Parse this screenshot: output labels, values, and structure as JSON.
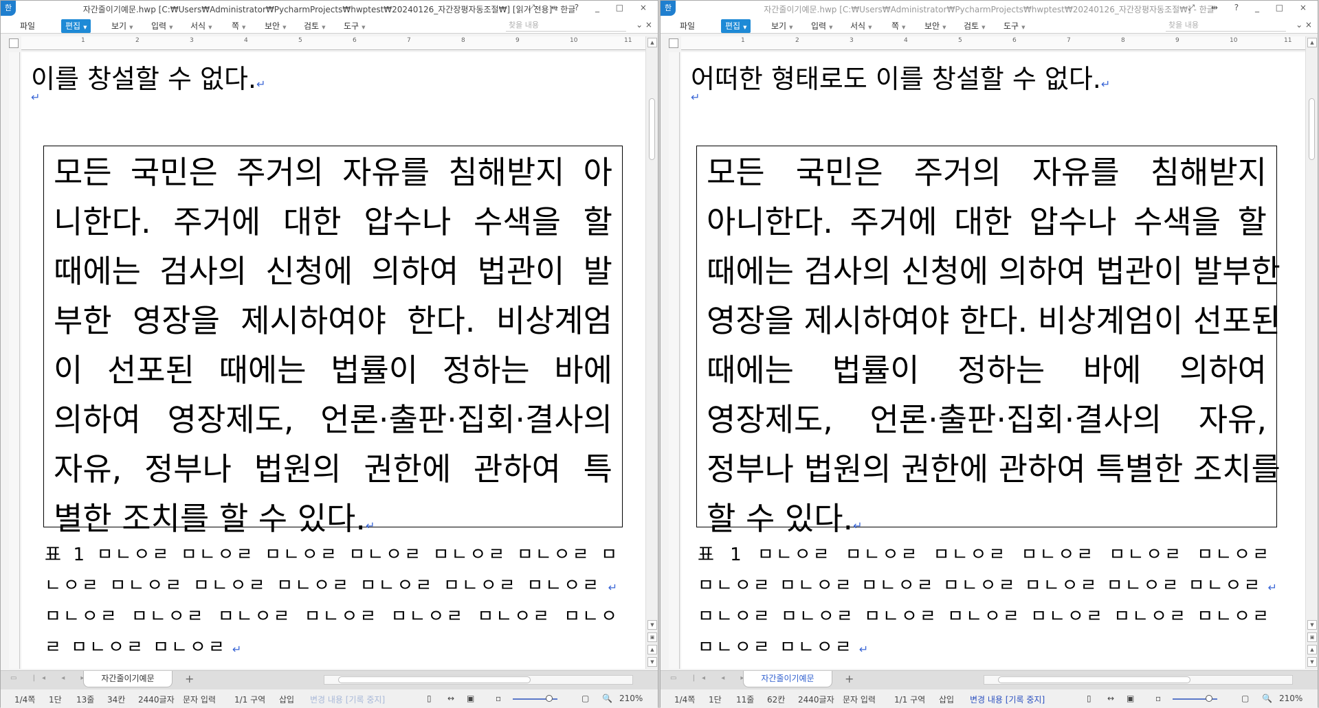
{
  "menu_items": [
    "파일",
    "편집",
    "보기",
    "입력",
    "서식",
    "쪽",
    "보안",
    "검토",
    "도구"
  ],
  "search_placeholder": "찾을 내용",
  "ruler_marks": [
    "1",
    "2",
    "3",
    "4",
    "5",
    "6",
    "7",
    "8",
    "9",
    "10",
    "11"
  ],
  "window_controls": "⤢ ⇹ ? _ □ ×",
  "colors": {
    "accent": "#1e8ad6",
    "return_mark": "#3a66d6",
    "track_changes_active": "#2a4fbf"
  },
  "windows": [
    {
      "app_icon": "한",
      "title": "자간줄이기예문.hwp [C:₩Users₩Administrator₩PycharmProjects₩hwptest₩20240126_자간장평자동조절₩] [읽기 전용] - 한글",
      "first_line": "이를 창설할 수 없다.",
      "box_lines": [
        "모든 국민은 주거의 자유를 침해받지 아",
        "니한다. 주거에 대한 압수나 수색을 할",
        "때에는 검사의 신청에 의하여 법관이 발",
        "부한 영장을 제시하여야 한다. 비상계엄",
        "이 선포된 때에는 법률이 정하는 바에",
        "의하여 영장제도, 언론·출판·집회·결사의",
        "자유, 정부나 법원의 권한에 관하여 특",
        "별한 조치를 할 수 있다."
      ],
      "caption_lines": [
        "표 1 ㅁㄴㅇㄹ ㅁㄴㅇㄹ ㅁㄴㅇㄹ ㅁㄴㅇㄹ ㅁㄴㅇㄹ ㅁㄴㅇㄹ ㅁ",
        "ㄴㅇㄹ ㅁㄴㅇㄹ ㅁㄴㅇㄹ ㅁㄴㅇㄹ ㅁㄴㅇㄹ ㅁㄴㅇㄹ ㅁㄴㅇㄹ",
        "ㅁㄴㅇㄹ ㅁㄴㅇㄹ ㅁㄴㅇㄹ ㅁㄴㅇㄹ ㅁㄴㅇㄹ ㅁㄴㅇㄹ ㅁㄴㅇ",
        "ㄹ ㅁㄴㅇㄹ ㅁㄴㅇㄹ"
      ],
      "caption_return_after": [
        1,
        3
      ],
      "doc_tab": "자간줄이기예문",
      "status": [
        "1/4쪽",
        "1단",
        "13줄",
        "34칸",
        "2440글자",
        "문자 입력",
        "1/1 구역",
        "삽입",
        "변경 내용 [기록 중지]",
        "210%"
      ],
      "track_changes_active": false
    },
    {
      "app_icon": "한",
      "title": "자간줄이기예문.hwp [C:₩Users₩Administrator₩PycharmProjects₩hwptest₩20240126_자간장평자동조절₩] - 한글",
      "first_line": "어떠한 형태로도 이를 창설할 수 없다.",
      "box_lines": [
        "모든 국민은 주거의 자유를 침해받지",
        "아니한다. 주거에 대한 압수나 수색을 할",
        "때에는 검사의 신청에 의하여 법관이 발부한",
        "영장을 제시하여야 한다. 비상계엄이 선포된",
        "때에는 법률이 정하는 바에 의하여",
        "영장제도, 언론·출판·집회·결사의 자유,",
        "정부나 법원의 권한에 관하여 특별한 조치를",
        "할 수 있다."
      ],
      "caption_lines": [
        "표 1 ㅁㄴㅇㄹ ㅁㄴㅇㄹ ㅁㄴㅇㄹ ㅁㄴㅇㄹ ㅁㄴㅇㄹ ㅁㄴㅇㄹ",
        "ㅁㄴㅇㄹ ㅁㄴㅇㄹ ㅁㄴㅇㄹ ㅁㄴㅇㄹ ㅁㄴㅇㄹ ㅁㄴㅇㄹ ㅁㄴㅇㄹ",
        "ㅁㄴㅇㄹ ㅁㄴㅇㄹ ㅁㄴㅇㄹ ㅁㄴㅇㄹ ㅁㄴㅇㄹ ㅁㄴㅇㄹ ㅁㄴㅇㄹ",
        "ㅁㄴㅇㄹ ㅁㄴㅇㄹ"
      ],
      "caption_return_after": [
        1,
        3
      ],
      "doc_tab": "자간줄이기예문",
      "status": [
        "1/4쪽",
        "1단",
        "11줄",
        "62칸",
        "2440글자",
        "문자 입력",
        "1/1 구역",
        "삽입",
        "변경 내용 [기록 중지]",
        "210%"
      ],
      "track_changes_active": true
    }
  ]
}
